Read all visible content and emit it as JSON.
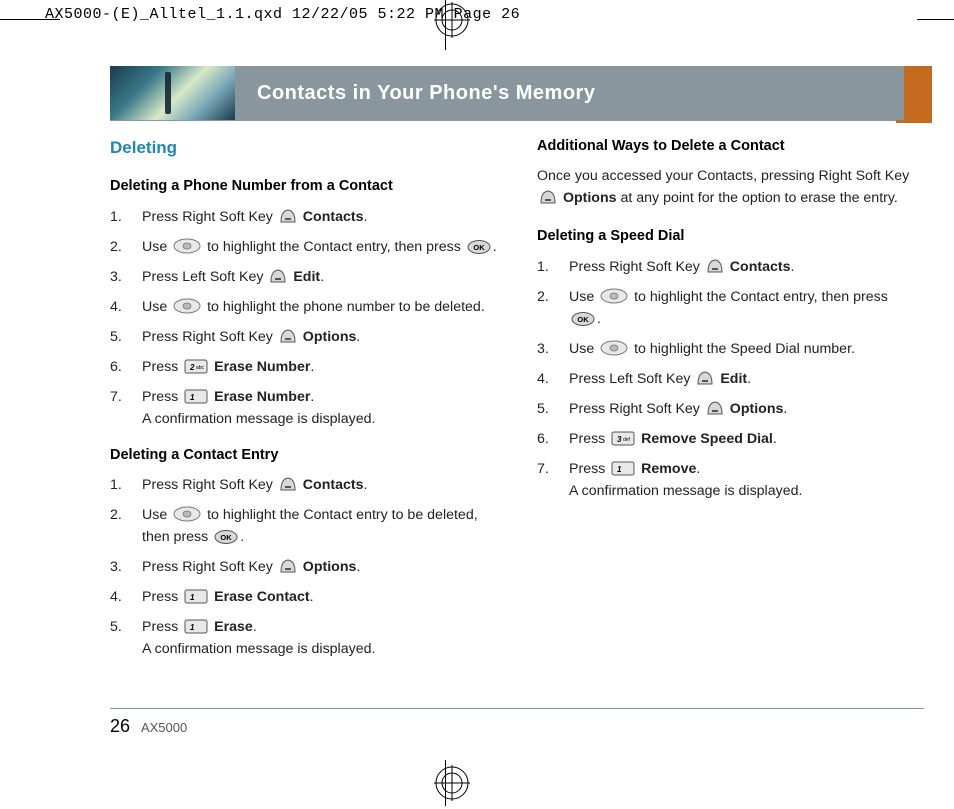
{
  "slug": "AX5000-(E)_Alltel_1.1.qxd  12/22/05  5:22 PM  Page 26",
  "bandTitle": "Contacts in Your Phone's Memory",
  "sectionTitle": "Deleting",
  "left": {
    "sub1": "Deleting a Phone Number from a Contact",
    "steps1": {
      "s1a": "Press Right Soft Key ",
      "s1b": " Contacts",
      "s2a": "Use ",
      "s2b": " to highlight the Contact entry, then press ",
      "s3a": "Press Left Soft Key ",
      "s3b": " Edit",
      "s4a": "Use ",
      "s4b": " to highlight the phone number to be deleted.",
      "s5a": "Press Right Soft Key ",
      "s5b": " Options",
      "s6a": "Press ",
      "s6b": " Erase Number",
      "s7a": "Press ",
      "s7b": " Erase Number",
      "s7c": "A confirmation message is displayed."
    },
    "sub2": "Deleting a Contact Entry",
    "steps2": {
      "s1a": "Press Right Soft Key ",
      "s1b": " Contacts",
      "s2a": "Use ",
      "s2b": " to highlight the Contact entry to be deleted, then press ",
      "s3a": "Press Right Soft Key ",
      "s3b": " Options",
      "s4a": "Press ",
      "s4b": " Erase Contact",
      "s5a": "Press ",
      "s5b": " Erase",
      "s5c": "A confirmation message is displayed."
    }
  },
  "right": {
    "sub3": "Additional Ways to Delete a Contact",
    "para3a": "Once you accessed your Contacts, pressing Right Soft Key ",
    "para3b": " Options",
    "para3c": " at any point for the option to erase the entry.",
    "sub4": "Deleting a Speed Dial",
    "steps4": {
      "s1a": "Press Right Soft Key ",
      "s1b": " Contacts",
      "s2a": "Use ",
      "s2b": " to highlight the Contact entry, then press ",
      "s3a": "Use ",
      "s3b": " to highlight the Speed Dial number.",
      "s4a": "Press Left Soft Key ",
      "s4b": " Edit",
      "s5a": "Press Right Soft Key ",
      "s5b": " Options",
      "s6a": "Press ",
      "s6b": " Remove Speed Dial",
      "s7a": "Press ",
      "s7b": " Remove",
      "s7c": "A confirmation message is displayed."
    }
  },
  "footer": {
    "page": "26",
    "model": "AX5000"
  }
}
